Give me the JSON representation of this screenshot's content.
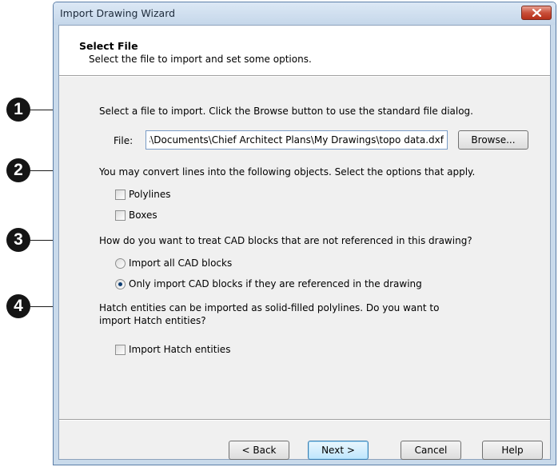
{
  "window": {
    "title": "Import Drawing Wizard"
  },
  "header": {
    "title": "Select File",
    "subtitle": "Select the file to import and set some options."
  },
  "callouts": [
    "1",
    "2",
    "3",
    "4"
  ],
  "sections": {
    "file": {
      "instruction": "Select a file to import. Click the Browse button to use the standard file dialog.",
      "label": "File:",
      "value": "C:\\Users\\Documents\\Chief Architect Plans\\My Drawings\\topo data.dxf",
      "browse_label": "Browse..."
    },
    "convert": {
      "instruction": "You may convert lines into the following objects. Select the options that apply.",
      "options": [
        {
          "label": "Polylines",
          "checked": false
        },
        {
          "label": "Boxes",
          "checked": false
        }
      ]
    },
    "blocks": {
      "instruction": "How do you want to treat CAD blocks that are not referenced in this drawing?",
      "options": [
        {
          "label": "Import all CAD blocks",
          "selected": false
        },
        {
          "label": "Only import CAD blocks if they are referenced in the drawing",
          "selected": true
        }
      ]
    },
    "hatch": {
      "instruction_line1": "Hatch entities can be imported as solid-filled polylines. Do you want to",
      "instruction_line2": "import Hatch entities?",
      "checkbox_label": "Import Hatch entities",
      "checked": false
    }
  },
  "footer": {
    "back_label": "< Back",
    "next_label": "Next >",
    "cancel_label": "Cancel",
    "help_label": "Help"
  },
  "colors": {
    "window_frame": "#c9daeb",
    "close_button": "#c9503a",
    "callout": "#151515"
  }
}
